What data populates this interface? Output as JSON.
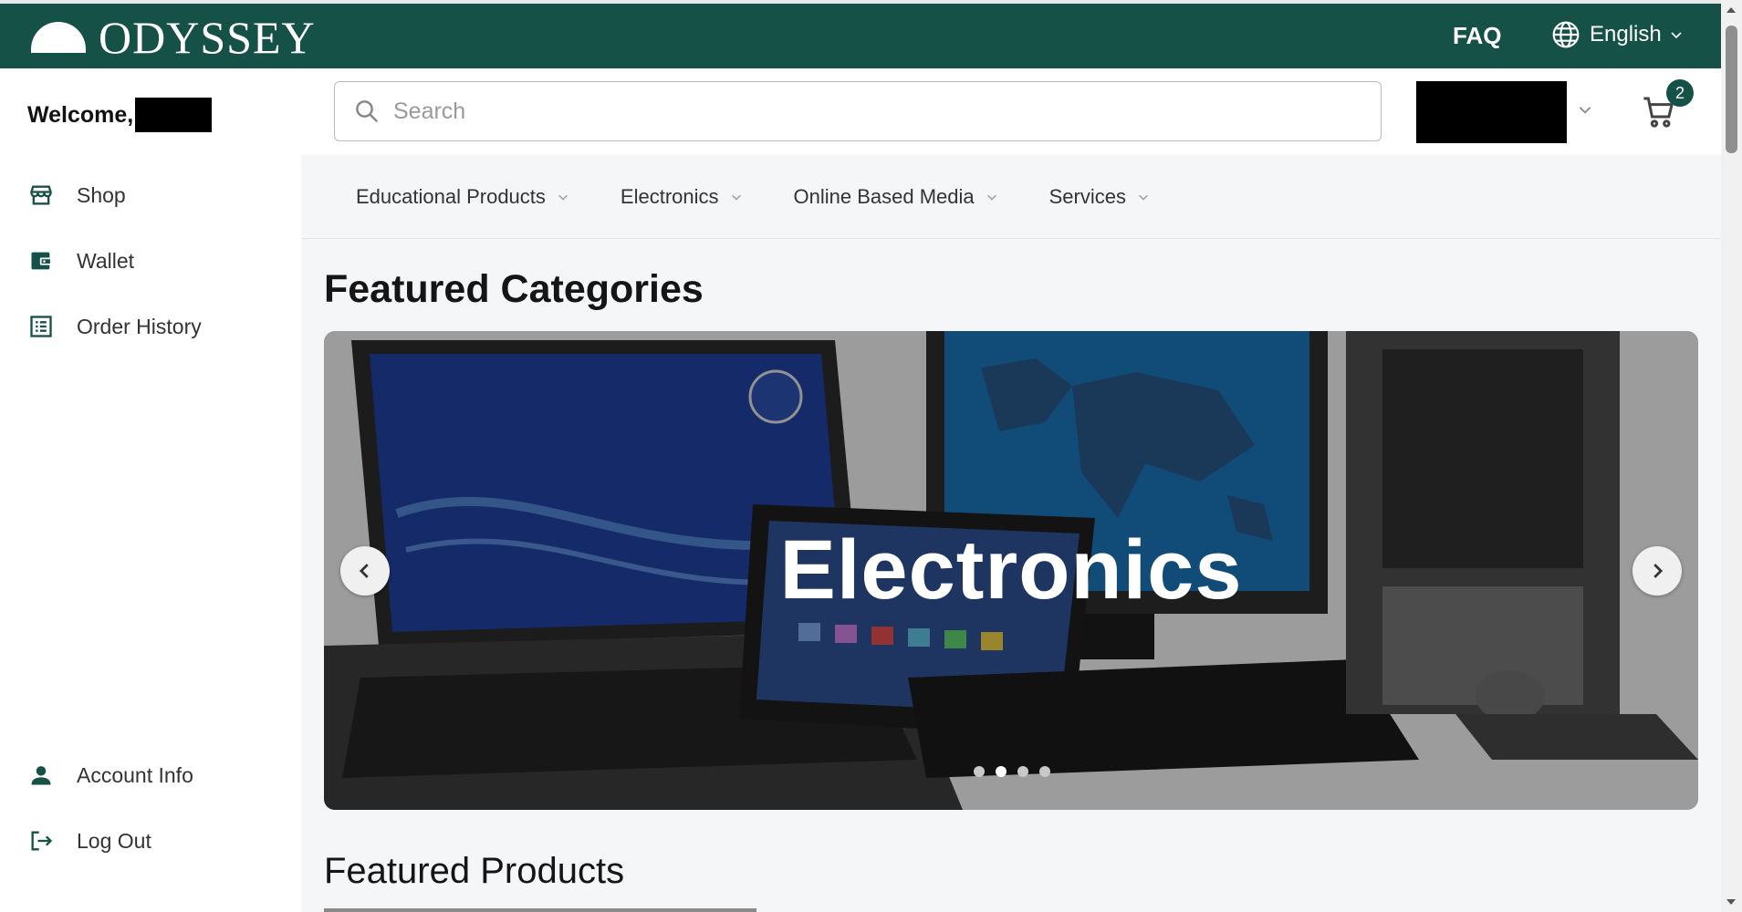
{
  "header": {
    "brand": "ODYSSEY",
    "faq_label": "FAQ",
    "language": "English"
  },
  "sidebar": {
    "welcome_label": "Welcome,",
    "items": [
      {
        "label": "Shop",
        "icon": "storefront-icon"
      },
      {
        "label": "Wallet",
        "icon": "wallet-icon"
      },
      {
        "label": "Order History",
        "icon": "receipt-list-icon"
      }
    ],
    "bottom_items": [
      {
        "label": "Account Info",
        "icon": "person-icon"
      },
      {
        "label": "Log Out",
        "icon": "logout-icon"
      }
    ]
  },
  "search": {
    "placeholder": "Search",
    "value": ""
  },
  "cart": {
    "count": "2"
  },
  "categories": [
    {
      "label": "Educational Products"
    },
    {
      "label": "Electronics"
    },
    {
      "label": "Online Based Media"
    },
    {
      "label": "Services"
    }
  ],
  "featured_categories": {
    "title": "Featured Categories",
    "slide_caption": "Electronics",
    "slide_count": 4,
    "active_slide": 2
  },
  "featured_products": {
    "title": "Featured Products"
  },
  "colors": {
    "brand": "#165148",
    "background": "#f5f6f8"
  }
}
